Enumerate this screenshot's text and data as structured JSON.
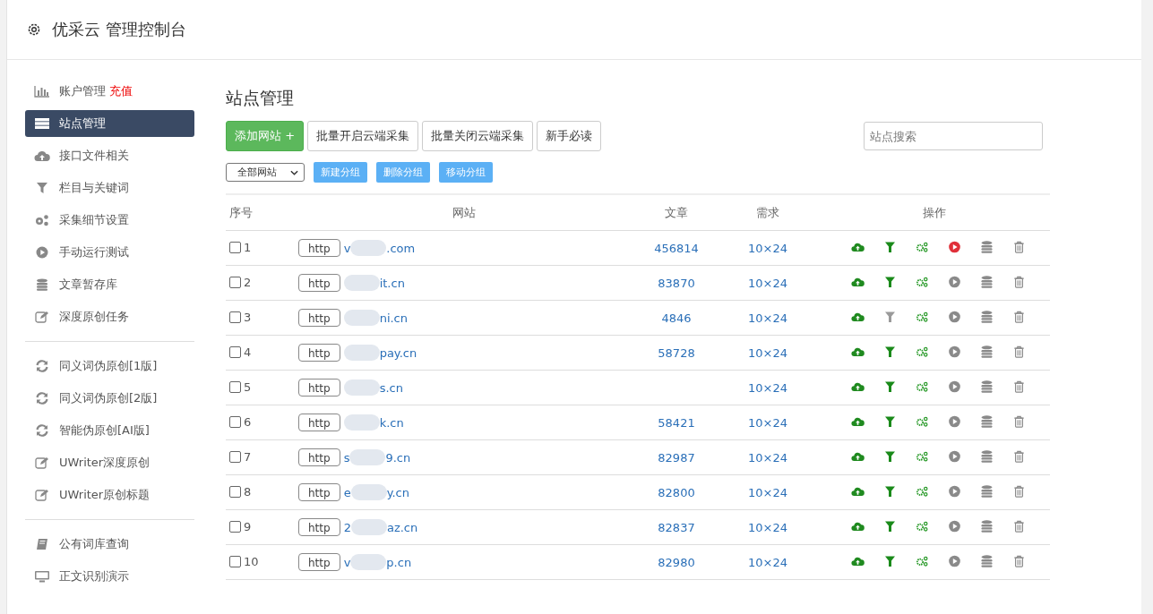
{
  "header": {
    "title": "优采云 管理控制台"
  },
  "sidebar": {
    "groups": [
      [
        {
          "kind": "chart",
          "label": "账户管理",
          "link": "充值",
          "selected": false
        },
        {
          "kind": "server",
          "label": "站点管理",
          "selected": true
        },
        {
          "kind": "cloud",
          "label": "接口文件相关",
          "selected": false
        },
        {
          "kind": "filter",
          "label": "栏目与关键词",
          "selected": false
        },
        {
          "kind": "gears",
          "label": "采集细节设置",
          "selected": false
        },
        {
          "kind": "play",
          "label": "手动运行测试",
          "selected": false
        },
        {
          "kind": "database",
          "label": "文章暂存库",
          "selected": false
        },
        {
          "kind": "edit",
          "label": "深度原创任务",
          "selected": false
        }
      ],
      [
        {
          "kind": "refresh",
          "label": "同义词伪原创[1版]",
          "selected": false
        },
        {
          "kind": "refresh",
          "label": "同义词伪原创[2版]",
          "selected": false
        },
        {
          "kind": "refresh",
          "label": "智能伪原创[AI版]",
          "selected": false
        },
        {
          "kind": "edit",
          "label": "UWriter深度原创",
          "selected": false
        },
        {
          "kind": "edit",
          "label": "UWriter原创标题",
          "selected": false
        }
      ],
      [
        {
          "kind": "book",
          "label": "公有词库查询",
          "selected": false
        },
        {
          "kind": "monitor",
          "label": "正文识别演示",
          "selected": false
        }
      ]
    ]
  },
  "main": {
    "title": "站点管理",
    "buttons": [
      {
        "kind": "primary",
        "label": "添加网站 +"
      },
      {
        "kind": "default",
        "label": "批量开启云端采集"
      },
      {
        "kind": "default",
        "label": "批量关闭云端采集"
      },
      {
        "kind": "default",
        "label": "新手必读"
      }
    ],
    "search": {
      "placeholder": "站点搜索"
    },
    "group_select": {
      "value": "全部网站"
    },
    "group_buttons": [
      "新建分组",
      "删除分组",
      "移动分组"
    ],
    "table": {
      "columns": [
        "序号",
        "网站",
        "文章",
        "需求",
        "操作"
      ],
      "rows": [
        {
          "checked": false,
          "index": "1",
          "scheme": "http",
          "domain_start": "v",
          "domain_end": ".com",
          "articles": "456814",
          "need": "10×24",
          "filter_on": true,
          "running": true
        },
        {
          "checked": false,
          "index": "2",
          "scheme": "http",
          "domain_end": "it.cn",
          "articles": "83870",
          "need": "10×24",
          "filter_on": true,
          "running": false
        },
        {
          "checked": false,
          "index": "3",
          "scheme": "http",
          "domain_end": "ni.cn",
          "articles": "4846",
          "need": "10×24",
          "filter_on": false,
          "running": false
        },
        {
          "checked": false,
          "index": "4",
          "scheme": "http",
          "domain_end": "pay.cn",
          "articles": "58728",
          "need": "10×24",
          "filter_on": true,
          "running": false
        },
        {
          "checked": false,
          "index": "5",
          "scheme": "http",
          "domain_end": "s.cn",
          "need": "10×24",
          "filter_on": true,
          "running": false
        },
        {
          "checked": false,
          "index": "6",
          "scheme": "http",
          "domain_end": "k.cn",
          "articles": "58421",
          "need": "10×24",
          "filter_on": true,
          "running": false
        },
        {
          "checked": false,
          "index": "7",
          "scheme": "http",
          "domain_start": "s",
          "domain_end": "9.cn",
          "articles": "82987",
          "need": "10×24",
          "filter_on": true,
          "running": false
        },
        {
          "checked": false,
          "index": "8",
          "scheme": "http",
          "domain_start": "e",
          "domain_end": "y.cn",
          "articles": "82800",
          "need": "10×24",
          "filter_on": true,
          "running": false
        },
        {
          "checked": false,
          "index": "9",
          "scheme": "http",
          "domain_start": "2",
          "domain_end": "az.cn",
          "articles": "82837",
          "need": "10×24",
          "filter_on": true,
          "running": false
        },
        {
          "checked": false,
          "index": "10",
          "scheme": "http",
          "domain_start": "v",
          "domain_end": "p.cn",
          "articles": "82980",
          "need": "10×24",
          "filter_on": true,
          "running": false
        }
      ]
    }
  }
}
